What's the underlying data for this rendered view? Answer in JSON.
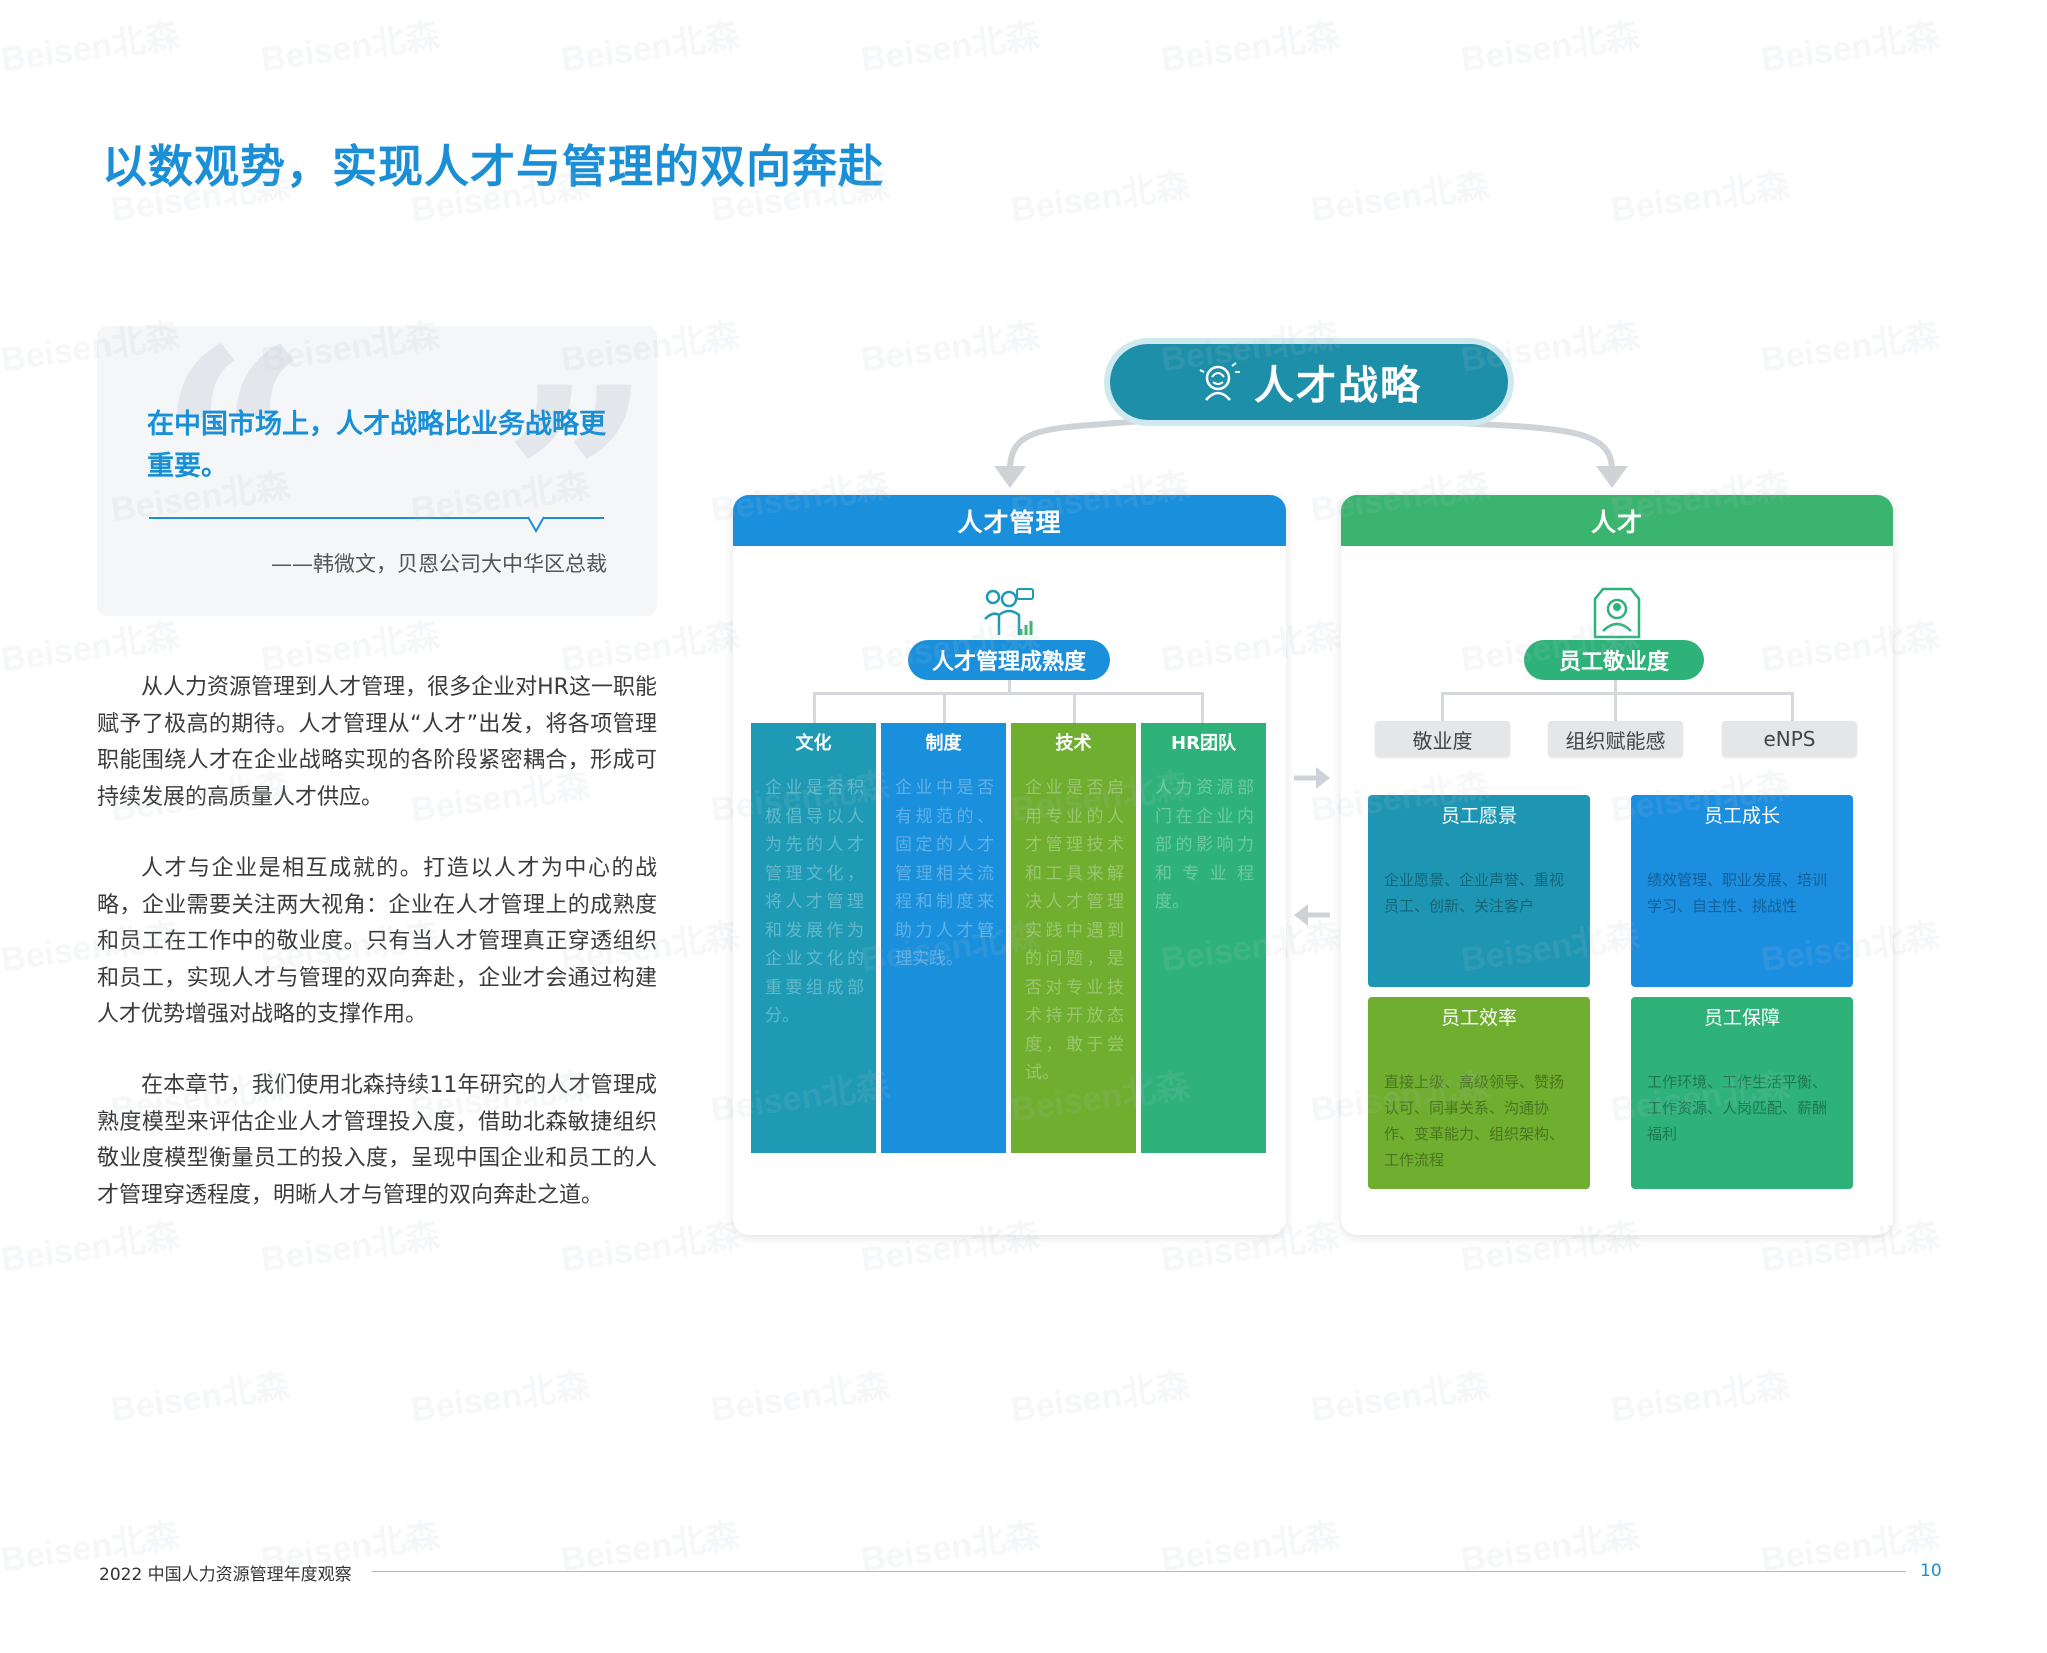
{
  "page": {
    "title": "以数观势，实现人才与管理的双向奔赴",
    "watermark": "Beisen北森"
  },
  "quote": {
    "text": "在中国市场上，人才战略比业务战略更重要。",
    "author": "——韩微文，贝恩公司大中华区总裁"
  },
  "body_paragraphs": [
    "从人力资源管理到人才管理，很多企业对HR这一职能赋予了极高的期待。人才管理从“人才”出发，将各项管理职能围绕人才在企业战略实现的各阶段紧密耦合，形成可持续发展的高质量人才供应。",
    "人才与企业是相互成就的。打造以人才为中心的战略，企业需要关注两大视角：企业在人才管理上的成熟度和员工在工作中的敬业度。只有当人才管理真正穿透组织和员工，实现人才与管理的双向奔赴，企业才会通过构建人才优势增强对战略的支撑作用。",
    "在本章节，我们使用北森持续11年研究的人才管理成熟度模型来评估企业人才管理投入度，借助北森敏捷组织敬业度模型衡量员工的投入度，呈现中国企业和员工的人才管理穿透程度，明晰人才与管理的双向奔赴之道。"
  ],
  "diagram": {
    "top": "人才战略",
    "left_panel": {
      "header": "人才管理",
      "subtitle": "人才管理成熟度",
      "columns": [
        {
          "title": "文化",
          "body": "企业是否积极倡导以人为先的人才管理文化，将人才管理和发展作为企业文化的重要组成部分。",
          "color": "#1e9ab5"
        },
        {
          "title": "制度",
          "body": "企业中是否有规范的、固定的人才管理相关流程和制度来助力人才管理实践。",
          "color": "#1a8fdc"
        },
        {
          "title": "技术",
          "body": "企业是否启用专业的人才管理技术和工具来解决人才管理实践中遇到的问题，是否对专业技术持开放态度，敢于尝试。",
          "color": "#6fae2f"
        },
        {
          "title": "HR团队",
          "body": "人力资源部门在企业内部的影响力和专业程度。",
          "color": "#2eb27a"
        }
      ]
    },
    "right_panel": {
      "header": "人才",
      "subtitle": "员工敬业度",
      "metrics": [
        "敬业度",
        "组织赋能感",
        "eNPS"
      ],
      "boxes": [
        {
          "title": "员工愿景",
          "body": "企业愿景、企业声誉、重视员工、创新、关注客户",
          "color": "#1e96b3"
        },
        {
          "title": "员工成长",
          "body": "绩效管理、职业发展、培训学习、自主性、挑战性",
          "color": "#1c8ee0"
        },
        {
          "title": "员工效率",
          "body": "直接上级、高级领导、赞扬认可、同事关系、沟通协作、变革能力、组织架构、工作流程",
          "color": "#6fae2f"
        },
        {
          "title": "员工保障",
          "body": "工作环境、工作生活平衡、工作资源、人岗匹配、薪酬福利",
          "color": "#2eb27a"
        }
      ]
    },
    "colors": {
      "primary_blue": "#1a8fd6",
      "teal": "#1e8fa9",
      "green": "#3bb46f"
    }
  },
  "footer": {
    "left": "2022 中国人力资源管理年度观察",
    "page_number": "10"
  }
}
